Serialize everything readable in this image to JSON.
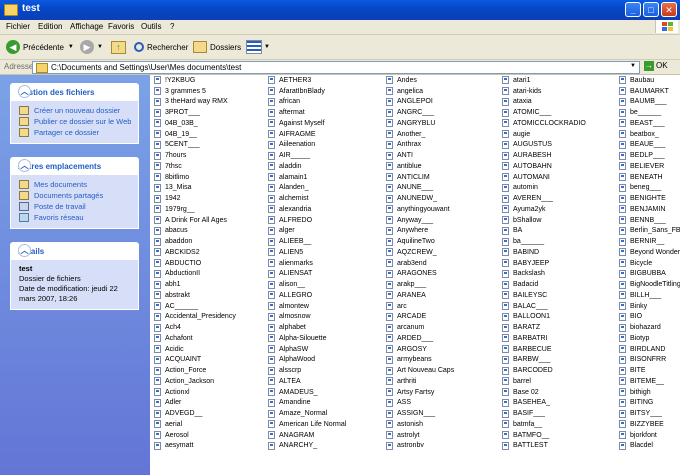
{
  "window": {
    "title": "test"
  },
  "menu": [
    "Fichier",
    "Edition",
    "Affichage",
    "Favoris",
    "Outils",
    "?"
  ],
  "toolbar": {
    "back": "Précédente",
    "search": "Rechercher",
    "folders": "Dossiers"
  },
  "address": {
    "label": "Adresse",
    "path": "C:\\Documents and Settings\\User\\Mes documents\\test",
    "go": "OK"
  },
  "sidebar": {
    "tasks": {
      "title": "Gestion des fichiers",
      "items": [
        "Créer un nouveau dossier",
        "Publier ce dossier sur le Web",
        "Partager ce dossier"
      ]
    },
    "places": {
      "title": "Autres emplacements",
      "items": [
        "Mes documents",
        "Documents partagés",
        "Poste de travail",
        "Favoris réseau"
      ]
    },
    "details": {
      "title": "Détails",
      "name": "test",
      "type": "Dossier de fichiers",
      "modified": "Date de modification: jeudi 22 mars 2007, 18:26"
    }
  },
  "columns": [
    [
      "!Y2KBUG",
      "3 grammes 5",
      "3 theHard way RMX",
      "3PROT___",
      "04B_03B_",
      "04B_19__",
      "5CENT___",
      "7hours",
      "7thsc",
      "8bitlimo",
      "13_Misa",
      "1942",
      "1979rg__",
      "A Drink For All Ages",
      "abacus",
      "abaddon",
      "ABCKIDS2",
      "ABDUCTIO",
      "AbductionII",
      "abh1",
      "abstrakt",
      "AC______",
      "Accidental_Presidency",
      "Ach4",
      "Achafont",
      "Acidic",
      "ACQUAINT",
      "Action_Force",
      "Action_Jackson",
      "Actionxl",
      "Adler",
      "ADVEGD__",
      "aerial",
      "Aerosol",
      "aesymatt"
    ],
    [
      "AETHER3",
      "AfaratIbnBlady",
      "african",
      "aftermat",
      "Against Myself",
      "AIFRAGME",
      "Aiileenation",
      "AIR_____",
      "aladdin",
      "alamain1",
      "Alanden_",
      "alchemist",
      "alexandria",
      "ALFREDO",
      "alger",
      "ALIEEB__",
      "ALIEN5",
      "alienmarks",
      "ALIENSAT",
      "alison__",
      "ALLEGRO",
      "almontew",
      "almosnow",
      "alphabet",
      "Alpha-Silouette",
      "AlphaSW",
      "AlphaWood",
      "alsscrp",
      "ALTEA",
      "AMADEUS_",
      "Amandine",
      "Amaze_Normal",
      "American Life Normal",
      "ANAGRAM",
      "ANARCHY_"
    ],
    [
      "Andes",
      "angelica",
      "ANGLEPOI",
      "ANGRC___",
      "ANGRYBLU",
      "Another_",
      "Anthrax",
      "ANTI",
      "antiblue",
      "ANTICLIM",
      "ANUNE___",
      "ANUNEDW_",
      "anythingyouwant",
      "Anyway___",
      "Anywhere",
      "AquilineTwo",
      "AQZCREW_",
      "arab3end",
      "ARAGONES",
      "arakp___",
      "ARANEA",
      "arc",
      "ARCADE",
      "arcanum",
      "ARDED___",
      "ARGOSY",
      "armybeans",
      "Art Nouveau Caps",
      "arthriti",
      "Artsy Fartsy",
      "ASS",
      "ASSIGN___",
      "astonish",
      "astrolyt",
      "astronbv"
    ],
    [
      "atari1",
      "atari-kids",
      "ataxia",
      "ATOMIC___",
      "ATOMICCLOCKRADIO",
      "augie",
      "AUGUSTUS",
      "AURABESH",
      "AUTOBAHN",
      "AUTOMANI",
      "automin",
      "AVEREN___",
      "Ayuma2yk",
      "bShallow",
      "BA",
      "ba______",
      "BABIND",
      "BABYJEEP",
      "Backslash",
      "Badacid",
      "BAILEYSC",
      "BALAC___",
      "BALLOON1",
      "BARATZ",
      "BARBATRI",
      "BARBECUE",
      "BARBW___",
      "BARCODED",
      "barrel",
      "Base 02",
      "BASEHEA_",
      "BASIF___",
      "batmfa__",
      "BATMFO__",
      "BATTLEST"
    ],
    [
      "Baubau",
      "BAUMARKT",
      "BAUMB___",
      "be______",
      "BEAST___",
      "beatbox_",
      "BEAUE___",
      "BEDLP___",
      "BELIEVER",
      "BENEATH",
      "beneg___",
      "BENIGHTE",
      "BENJAMIN",
      "BENNB___",
      "Berlin_Sans_FB",
      "BERNIR__",
      "Beyond Wonder",
      "Bicycle",
      "BIGBUBBA",
      "BigNoodleTitling",
      "BILLH___",
      "Binky",
      "BIO",
      "biohazard",
      "Biotyp",
      "BIRDLAND",
      "BISONFRR",
      "BITE",
      "BITEME__",
      "bithigh",
      "BITING",
      "BITSY___",
      "BIZZYBEE",
      "bjorkfont",
      "Blacdel"
    ]
  ]
}
